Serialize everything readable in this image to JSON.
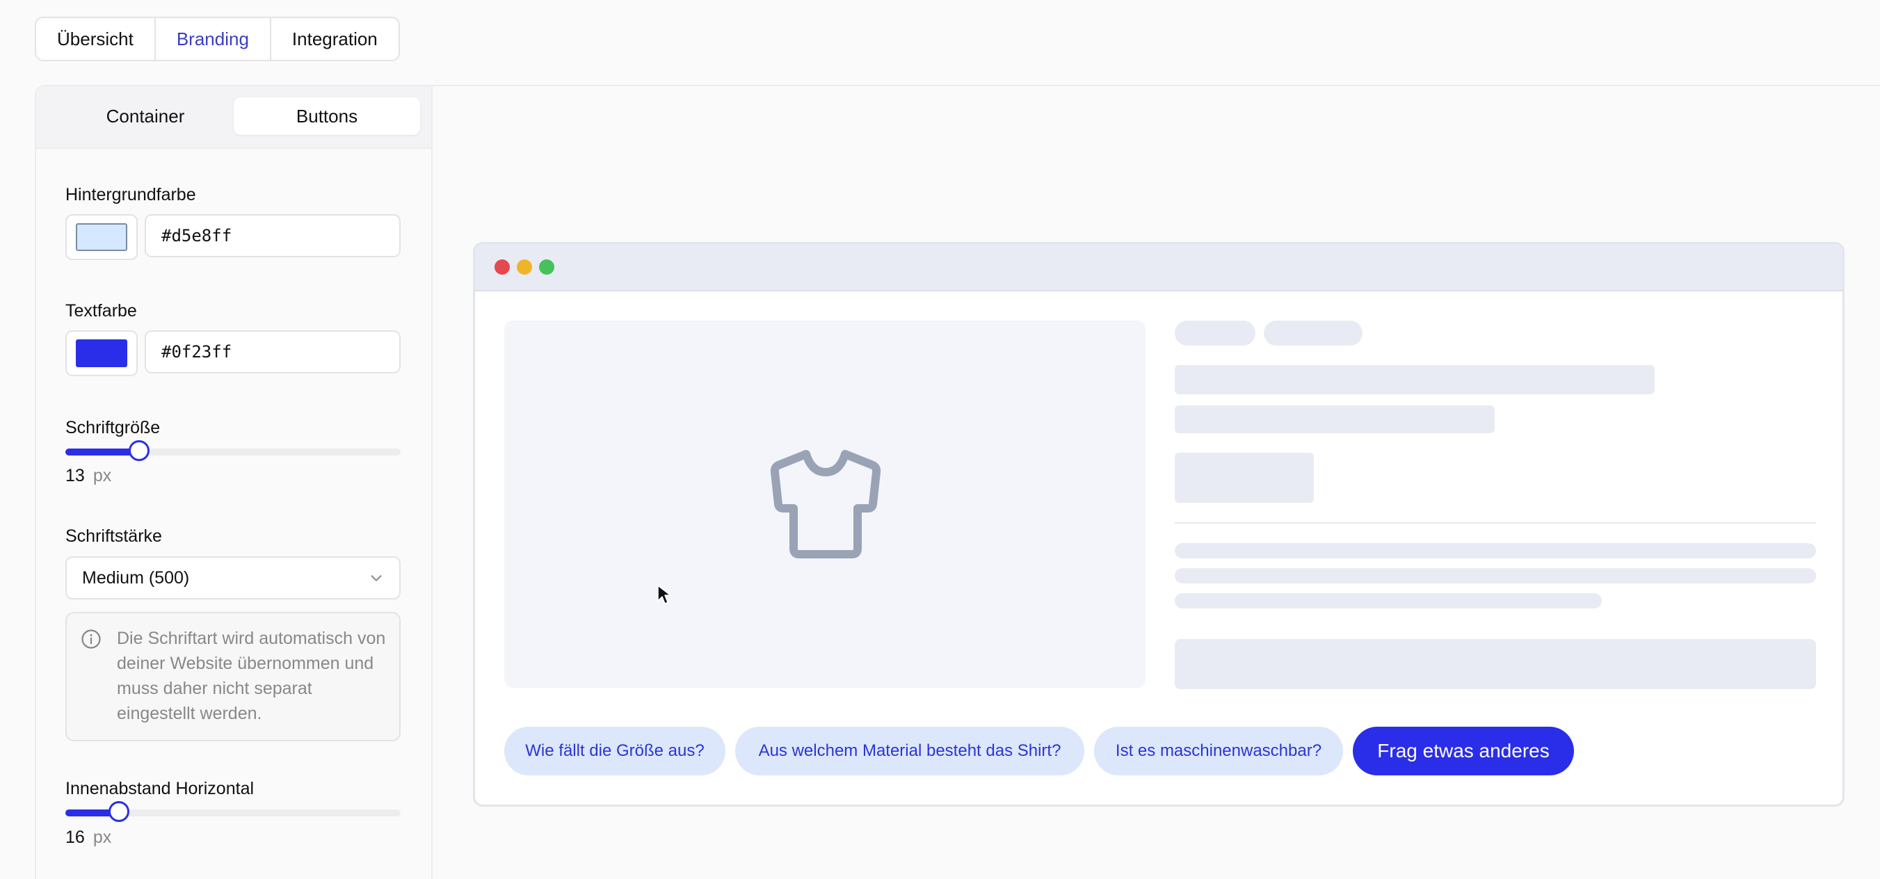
{
  "top_tabs": [
    {
      "label": "Übersicht"
    },
    {
      "label": "Branding",
      "active": true
    },
    {
      "label": "Integration"
    }
  ],
  "sub_tabs": [
    {
      "label": "Container"
    },
    {
      "label": "Buttons",
      "active": true
    }
  ],
  "background_color": {
    "label": "Hintergrundfarbe",
    "value": "#d5e8ff"
  },
  "text_color": {
    "label": "Textfarbe",
    "value": "#0f23ff"
  },
  "font_size": {
    "label": "Schriftgröße",
    "value": "13",
    "unit": "px",
    "fraction": 0.22
  },
  "font_weight": {
    "label": "Schriftstärke",
    "selected": "Medium (500)"
  },
  "font_info": "Die Schriftart wird automatisch von deiner Website übernommen und muss daher nicht separat eingestellt werden.",
  "padding_horizontal": {
    "label": "Innenabstand Horizontal",
    "value": "16",
    "unit": "px",
    "fraction": 0.16
  },
  "preview": {
    "chips": [
      {
        "label": "Wie fällt die Größe aus?"
      },
      {
        "label": "Aus welchem Material besteht das Shirt?"
      },
      {
        "label": "Ist es maschinenwaschbar?"
      },
      {
        "label": "Frag etwas anderes",
        "primary": true
      }
    ]
  },
  "icons": [
    "info-icon",
    "chevron-down-icon",
    "shirt-icon",
    "cursor-icon"
  ],
  "colors": {
    "accent": "#2a2ee8",
    "active_tab_text": "#3b3ec4",
    "window_red": "#e5484d",
    "window_yellow": "#f0b429",
    "window_green": "#46c25a"
  }
}
